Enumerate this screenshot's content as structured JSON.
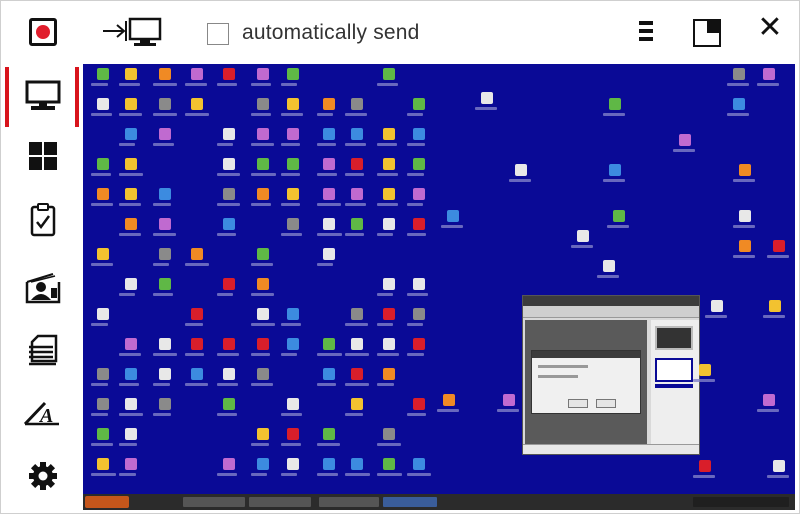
{
  "toolbar": {
    "record_icon": "record-icon",
    "send_icon": "send-to-screen-icon",
    "auto_send_label": "automatically send",
    "auto_send_checked": false,
    "menu_icon": "menu-icon",
    "split_view_icon": "split-view-icon",
    "close_icon": "close-icon"
  },
  "sidebar": {
    "items": [
      {
        "icon": "monitor-icon",
        "active": true
      },
      {
        "icon": "windows-grid-icon",
        "active": false
      },
      {
        "icon": "clipboard-check-icon",
        "active": false
      },
      {
        "icon": "presenter-icon",
        "active": false
      },
      {
        "icon": "document-lines-icon",
        "active": false
      },
      {
        "icon": "text-font-icon",
        "active": false
      },
      {
        "icon": "gear-icon",
        "active": false
      }
    ]
  },
  "colors": {
    "record": "#e11d2c",
    "active_indicator": "#d8141c",
    "desktop_background": "#0a0a96"
  }
}
